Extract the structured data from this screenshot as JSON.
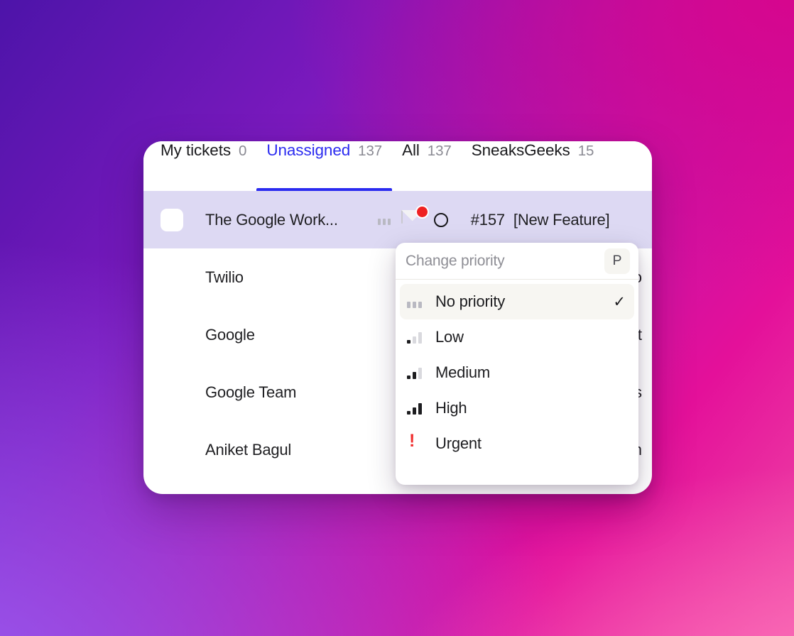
{
  "background": {
    "gradient_from": "#4d14a9",
    "gradient_mid": "#c012a6",
    "gradient_to": "#f04ba6"
  },
  "accent": {
    "active_tab_color": "#2b2bf0",
    "selected_row_bg": "#ddd9f3",
    "urgent_color": "#f03030",
    "badge_color": "#ef2222"
  },
  "tabs": [
    {
      "label": "My tickets",
      "count": "0",
      "active": false
    },
    {
      "label": "Unassigned",
      "count": "137",
      "active": true
    },
    {
      "label": "All",
      "count": "137",
      "active": false
    },
    {
      "label": "SneaksGeeks",
      "count": "15",
      "active": false
    }
  ],
  "rows": [
    {
      "title": "The Google Work...",
      "ticket_id": "#157",
      "subject": "[New Feature]",
      "selected": true,
      "right_fragment": ""
    },
    {
      "title": "Twilio",
      "selected": false,
      "right_fragment": "co"
    },
    {
      "title": "Google",
      "selected": false,
      "right_fragment": "t"
    },
    {
      "title": "Google Team",
      "selected": false,
      "right_fragment": "s"
    },
    {
      "title": "Aniket Bagul",
      "selected": false,
      "right_fragment": "m"
    }
  ],
  "dropdown": {
    "placeholder": "Change priority",
    "shortcut_key": "P",
    "items": [
      {
        "label": "No priority",
        "icon": "priority-none-icon",
        "selected": true,
        "check": "✓"
      },
      {
        "label": "Low",
        "icon": "priority-low-icon",
        "selected": false,
        "check": ""
      },
      {
        "label": "Medium",
        "icon": "priority-medium-icon",
        "selected": false,
        "check": ""
      },
      {
        "label": "High",
        "icon": "priority-high-icon",
        "selected": false,
        "check": ""
      },
      {
        "label": "Urgent",
        "icon": "priority-urgent-icon",
        "selected": false,
        "check": ""
      }
    ]
  }
}
